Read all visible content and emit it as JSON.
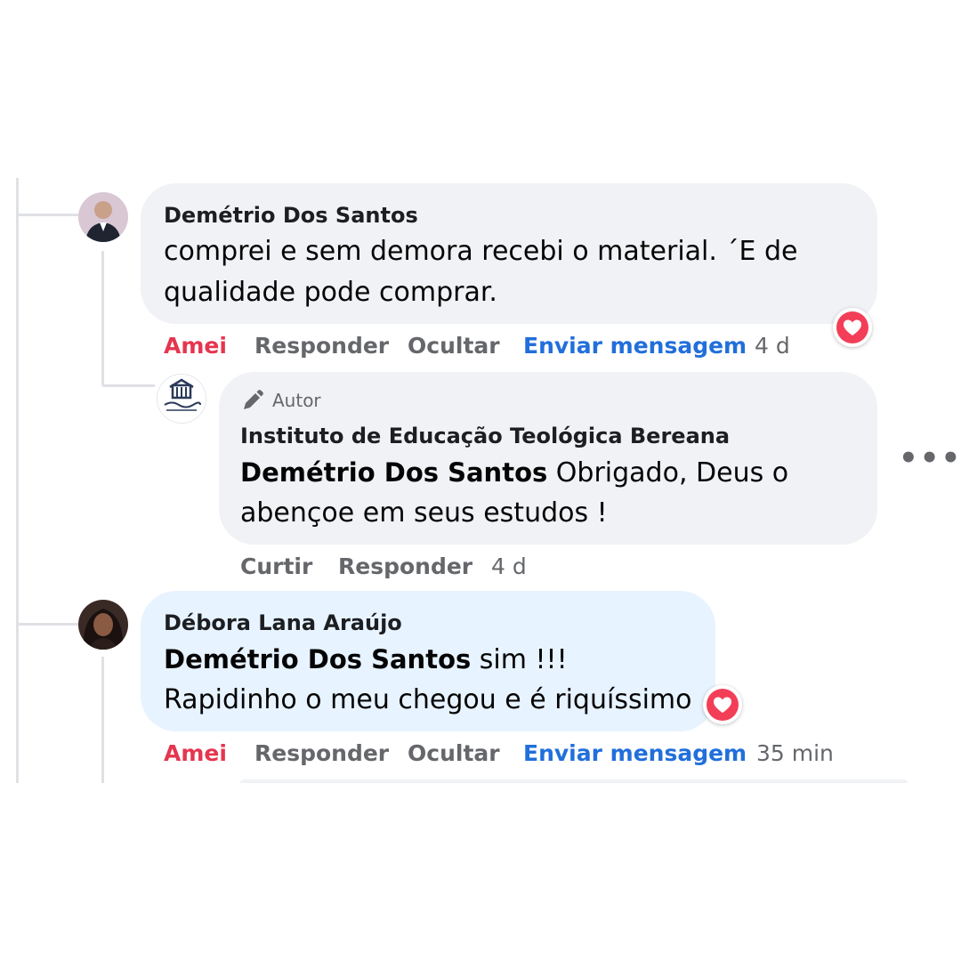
{
  "comments": [
    {
      "author": "Demétrio Dos Santos",
      "text_line1": "comprei e sem demora recebi o material. ´E de",
      "text_line2": "qualidade pode comprar.",
      "actions": {
        "react": "Amei",
        "reply": "Responder",
        "hide": "Ocultar",
        "message": "Enviar mensagem",
        "time": "4 d"
      },
      "reaction_icon": "heart-icon"
    },
    {
      "badge": "Autor",
      "author": "Instituto de Educação Teológica Bereana",
      "mention": "Demétrio Dos Santos",
      "text_line1": " Obrigado, Deus o",
      "text_line2": "abençoe em seus estudos !",
      "actions": {
        "react": "Curtir",
        "reply": "Responder",
        "time": "4 d"
      }
    },
    {
      "author": "Débora Lana Araújo",
      "mention": "Demétrio Dos Santos",
      "text_line1": " sim !!!",
      "text_line2": "Rapidinho o meu chegou e é riquíssimo",
      "actions": {
        "react": "Amei",
        "reply": "Responder",
        "hide": "Ocultar",
        "message": "Enviar mensagem",
        "time": "35 min"
      },
      "reaction_icon": "heart-icon"
    }
  ],
  "more_options": "•••",
  "colors": {
    "love": "#e4364f",
    "message_link": "#216fdb",
    "bubble_grey": "#f0f2f5",
    "bubble_blue": "#e7f3ff",
    "muted": "#65676b"
  }
}
